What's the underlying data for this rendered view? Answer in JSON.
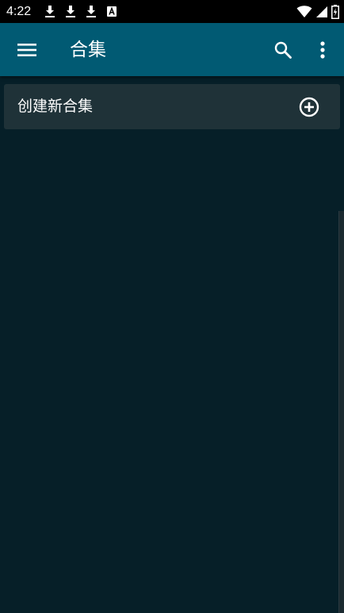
{
  "status_bar": {
    "time": "4:22",
    "notifications": [
      "download-icon",
      "download-icon",
      "download-icon",
      "a-letter-icon"
    ],
    "indicators": [
      "wifi-icon",
      "signal-icon",
      "battery-icon"
    ]
  },
  "app_bar": {
    "title": "合集",
    "background_color": "#015a73",
    "icons": [
      "menu-icon",
      "search-icon",
      "more-vert-icon"
    ]
  },
  "content": {
    "create_item": {
      "label": "创建新合集",
      "icon": "add-circle-icon"
    }
  },
  "colors": {
    "background": "#061f28",
    "card": "#1f3238",
    "status_bar": "#000000"
  }
}
